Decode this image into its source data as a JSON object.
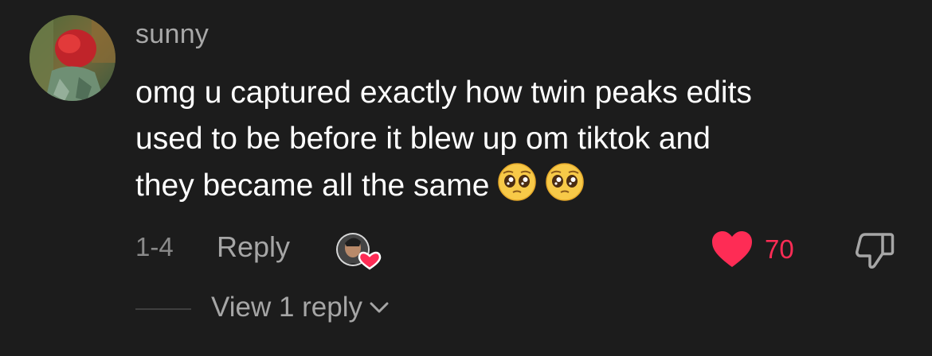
{
  "comment": {
    "username": "sunny",
    "text_lines": [
      "omg u captured exactly how twin peaks edits",
      "used to be before it blew up om tiktok and",
      "they became all the same"
    ],
    "emojis": [
      "pleading-face",
      "pleading-face"
    ],
    "date": "1-4",
    "reply_label": "Reply",
    "like_count": "70",
    "liked": true,
    "view_replies_label": "View 1 reply"
  },
  "colors": {
    "background": "#1c1c1c",
    "like": "#fe2c55",
    "secondary_text": "#a6a6a6"
  }
}
